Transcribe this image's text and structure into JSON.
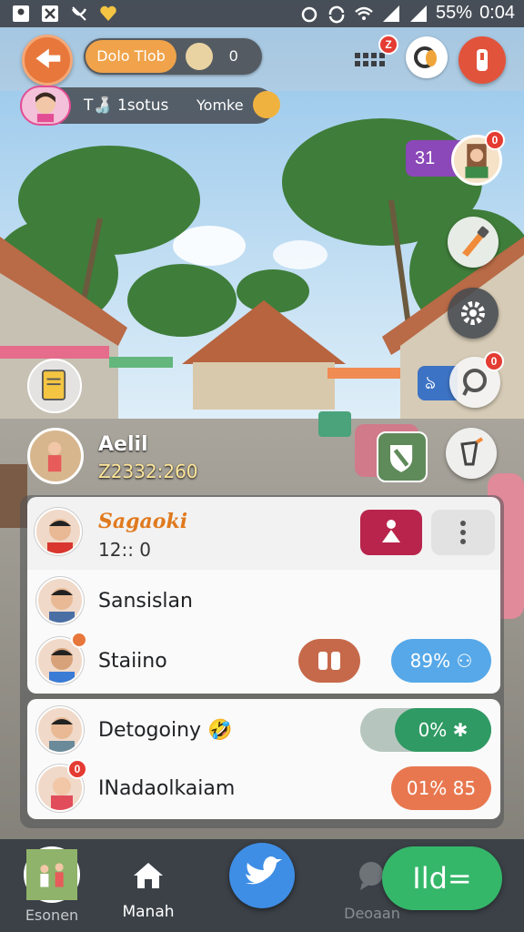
{
  "status_bar": {
    "battery": "55%",
    "time": "0:04"
  },
  "top_bar": {
    "channel_name": "Dolo Tlob",
    "viewer_count": "0",
    "grid_badge": "Z"
  },
  "streamer_bar": {
    "tag_label": "T🍶 1sotus",
    "mode_label": "Yomke"
  },
  "side": {
    "score_label": "31",
    "avatar_badge": "0",
    "blue_tab_label": "ঌ",
    "chat_badge": "0"
  },
  "host": {
    "name": "Aelil",
    "code": "Z2332:260"
  },
  "list": {
    "header": {
      "name": "Sagaoki",
      "time": "12:: 0"
    },
    "rows": [
      {
        "name": "Sansislan"
      },
      {
        "name": "Staiino",
        "action_label": "",
        "pill_label": "89%"
      },
      {
        "name": "Detogoiny 🤣",
        "pill_label": "0%"
      },
      {
        "name": "INadaolkaiam",
        "pill_label": "01% 85",
        "badge": "0"
      }
    ]
  },
  "bottom_nav": {
    "profile_label": "Esonen",
    "home_label": "Manah",
    "chat_label": "Deoaan",
    "cta_label": "Ild="
  },
  "colors": {
    "accent_orange": "#e8773b",
    "accent_blue": "#3f8ee6",
    "accent_green": "#35b76a",
    "alert_red": "#e43b32"
  }
}
